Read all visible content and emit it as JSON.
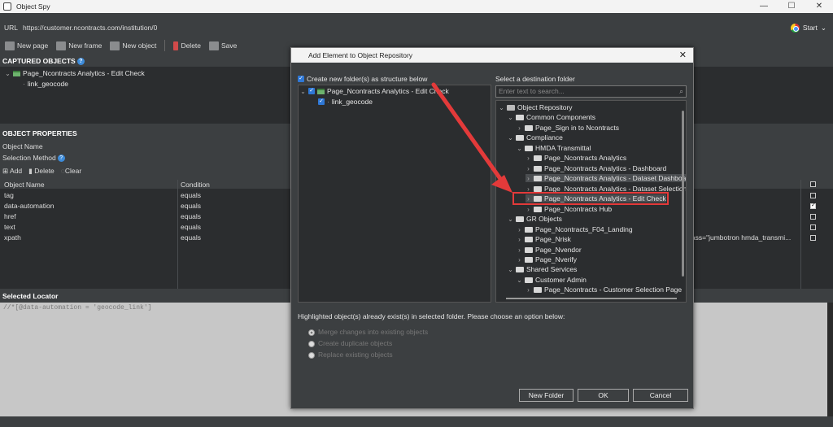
{
  "window": {
    "title": "Object Spy",
    "controls": {
      "minimize": "—",
      "maximize": "☐",
      "close": "✕"
    }
  },
  "url": {
    "label": "URL",
    "value": "https://customer.ncontracts.com/institution/0",
    "start_label": "Start"
  },
  "toolbar": {
    "new_page": "New page",
    "new_frame": "New frame",
    "new_object": "New object",
    "delete": "Delete",
    "save": "Save"
  },
  "captured": {
    "heading": "CAPTURED OBJECTS",
    "page": "Page_Ncontracts Analytics - Edit Check",
    "child": "link_geocode"
  },
  "properties": {
    "heading": "OBJECT PROPERTIES",
    "object_name_label": "Object Name",
    "selection_method_label": "Selection Method",
    "add": "Add",
    "delete": "Delete",
    "clear": "Clear",
    "columns": {
      "name": "Object Name",
      "condition": "Condition"
    },
    "rows": [
      {
        "name": "tag",
        "condition": "equals",
        "checked": false
      },
      {
        "name": "data-automation",
        "condition": "equals",
        "checked": true
      },
      {
        "name": "href",
        "condition": "equals",
        "checked": false
      },
      {
        "name": "text",
        "condition": "equals",
        "checked": false
      },
      {
        "name": "xpath",
        "condition": "equals",
        "value": "lass=\"jumbotron hmda_transmi...",
        "checked": false
      }
    ]
  },
  "locator": {
    "heading": "Selected Locator",
    "text": "//*[@data-automation = 'geocode_link']"
  },
  "dialog": {
    "title": "Add Element to Object Repository",
    "create_folders_label": "Create new folder(s) as structure below",
    "left_tree": {
      "page": "Page_Ncontracts Analytics - Edit Check",
      "child": "link_geocode"
    },
    "dest_label": "Select a destination folder",
    "search_placeholder": "Enter text to search...",
    "tree": {
      "root": "Object Repository",
      "common": "Common Components",
      "signin": "Page_Sign in to Ncontracts",
      "compliance": "Compliance",
      "hmda": "HMDA Transmittal",
      "analytics": "Page_Ncontracts Analytics",
      "dashboard": "Page_Ncontracts Analytics - Dashboard",
      "dataset_dash": "Page_Ncontracts Analytics - Dataset Dashboa",
      "dataset_sel": "Page_Ncontracts Analytics - Dataset Selection",
      "edit_check": "Page_Ncontracts Analytics - Edit Check",
      "hub": "Page_Ncontracts Hub",
      "gr": "GR Objects",
      "f04": "Page_Ncontracts_F04_Landing",
      "nrisk": "Page_Nrisk",
      "nvendor": "Page_Nvendor",
      "nverify": "Page_Nverify",
      "shared": "Shared Services",
      "customer_admin": "Customer Admin",
      "customer_sel": "Page_Ncontracts - Customer Selection Page"
    },
    "highlight_note": "Highlighted object(s) already exist(s) in selected folder. Please choose an option below:",
    "options": [
      "Merge changes into existing objects",
      "Create duplicate objects",
      "Replace existing objects"
    ],
    "buttons": {
      "new_folder": "New Folder",
      "ok": "OK",
      "cancel": "Cancel"
    }
  },
  "colors": {
    "accent": "#2f78d6",
    "annotation": "#e33a3a",
    "background": "#3c3f41"
  }
}
